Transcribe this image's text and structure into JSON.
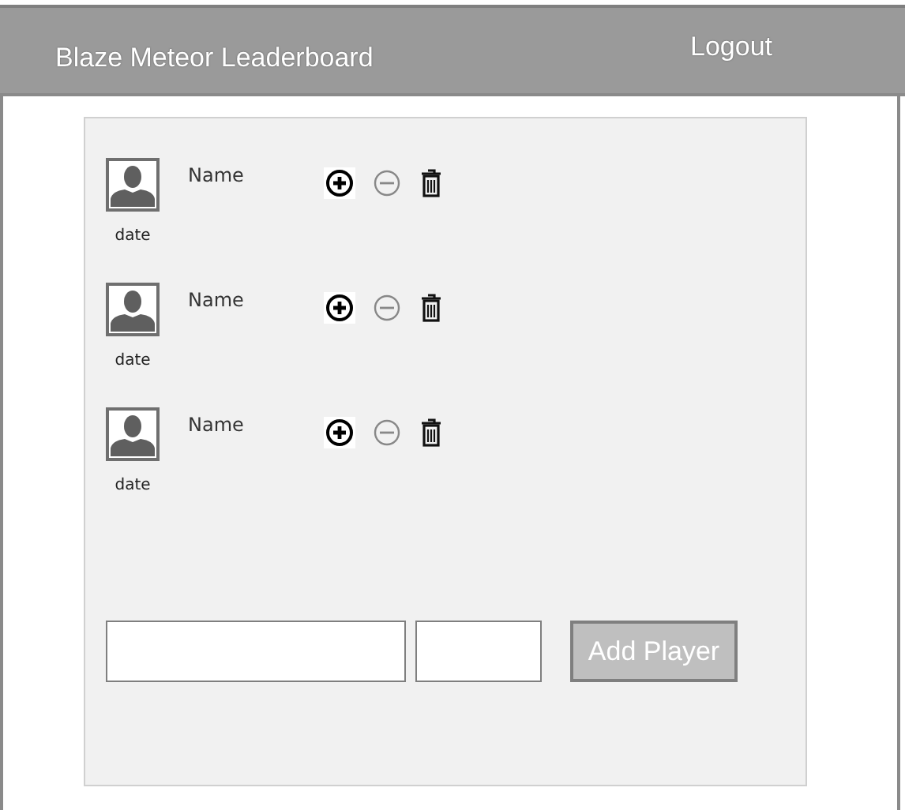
{
  "header": {
    "title": "Blaze Meteor Leaderboard",
    "logout": "Logout"
  },
  "players": [
    {
      "name": "Name",
      "date": "date"
    },
    {
      "name": "Name",
      "date": "date"
    },
    {
      "name": "Name",
      "date": "date"
    }
  ],
  "form": {
    "button": "Add Player"
  }
}
